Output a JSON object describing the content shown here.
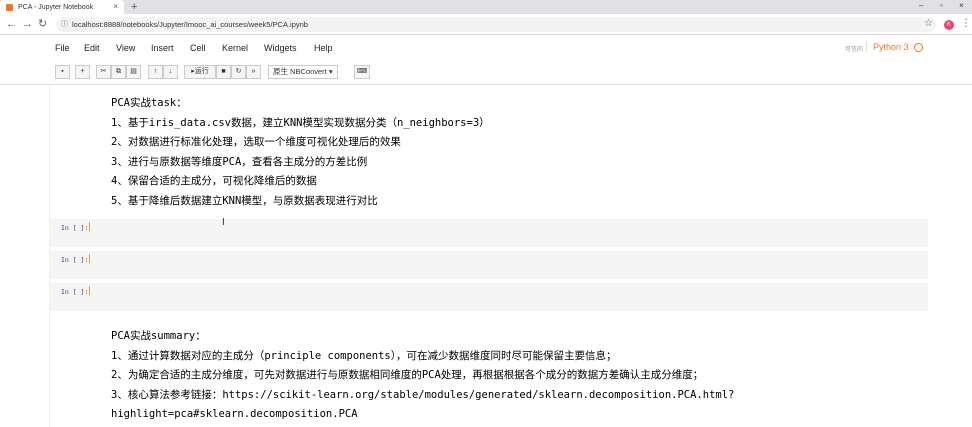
{
  "browser": {
    "tab_title": "PCA - Jupyter Notebook",
    "tab_close": "×",
    "new_tab": "+",
    "win_min": "–",
    "win_restore": "▫",
    "win_close": "×",
    "url": "localhost:8888/notebooks/Jupyter/Imooc_ai_courses/week5/PCA.ipynb",
    "avatar_letter": "K"
  },
  "menu": {
    "items": [
      "File",
      "Edit",
      "View",
      "Insert",
      "Cell",
      "Kernel",
      "Widgets",
      "Help"
    ],
    "trusted": "可信的",
    "kernel": "Python 3"
  },
  "toolbar": {
    "run_label": "运行",
    "cell_type": "原生 NBConvert"
  },
  "cells": {
    "task_lines": [
      "PCA实战task：",
      "1、基于iris_data.csv数据，建立KNN模型实现数据分类（n_neighbors=3）",
      "2、对数据进行标准化处理，选取一个维度可视化处理后的效果",
      "3、进行与原数据等维度PCA，查看各主成分的方差比例",
      "4、保留合适的主成分，可视化降维后的数据",
      "5、基于降维后数据建立KNN模型，与原数据表现进行对比"
    ],
    "code_prompts": [
      "In [ ]:",
      "In [ ]:",
      "In [ ]:"
    ],
    "summary_lines": [
      "PCA实战summary：",
      "1、通过计算数据对应的主成分（principle components），可在减少数据维度同时尽可能保留主要信息；",
      "2、为确定合适的主成分维度，可先对数据进行与原数据相同维度的PCA处理，再根据根据各个成分的数据方差确认主成分维度；",
      "3、核心算法参考链接：https://scikit-learn.org/stable/modules/generated/sklearn.decomposition.PCA.html?",
      "highlight=pca#sklearn.decomposition.PCA"
    ]
  },
  "colors": {
    "accent": "#f37626",
    "prompt": "#303f9f",
    "code_bg": "#f5f5f5"
  }
}
